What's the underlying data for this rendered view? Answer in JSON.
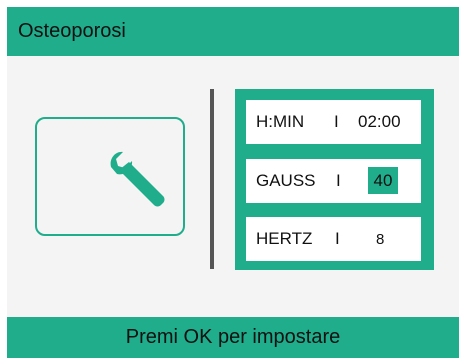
{
  "header": {
    "title": "Osteoporosi"
  },
  "tool_tile": {
    "icon": "wrench-icon"
  },
  "params": {
    "time_label": "H:MIN",
    "time_separator": "I",
    "time_value": "02:00",
    "gauss_label": "GAUSS",
    "gauss_separator": "I",
    "gauss_value": "40",
    "hertz_label": "HERTZ",
    "hertz_separator": "I",
    "hertz_value": "8"
  },
  "footer": {
    "hint": "Premi OK per impostare"
  },
  "colors": {
    "accent": "#1fad8c",
    "background": "#f4f4f4",
    "divider": "#555555"
  }
}
